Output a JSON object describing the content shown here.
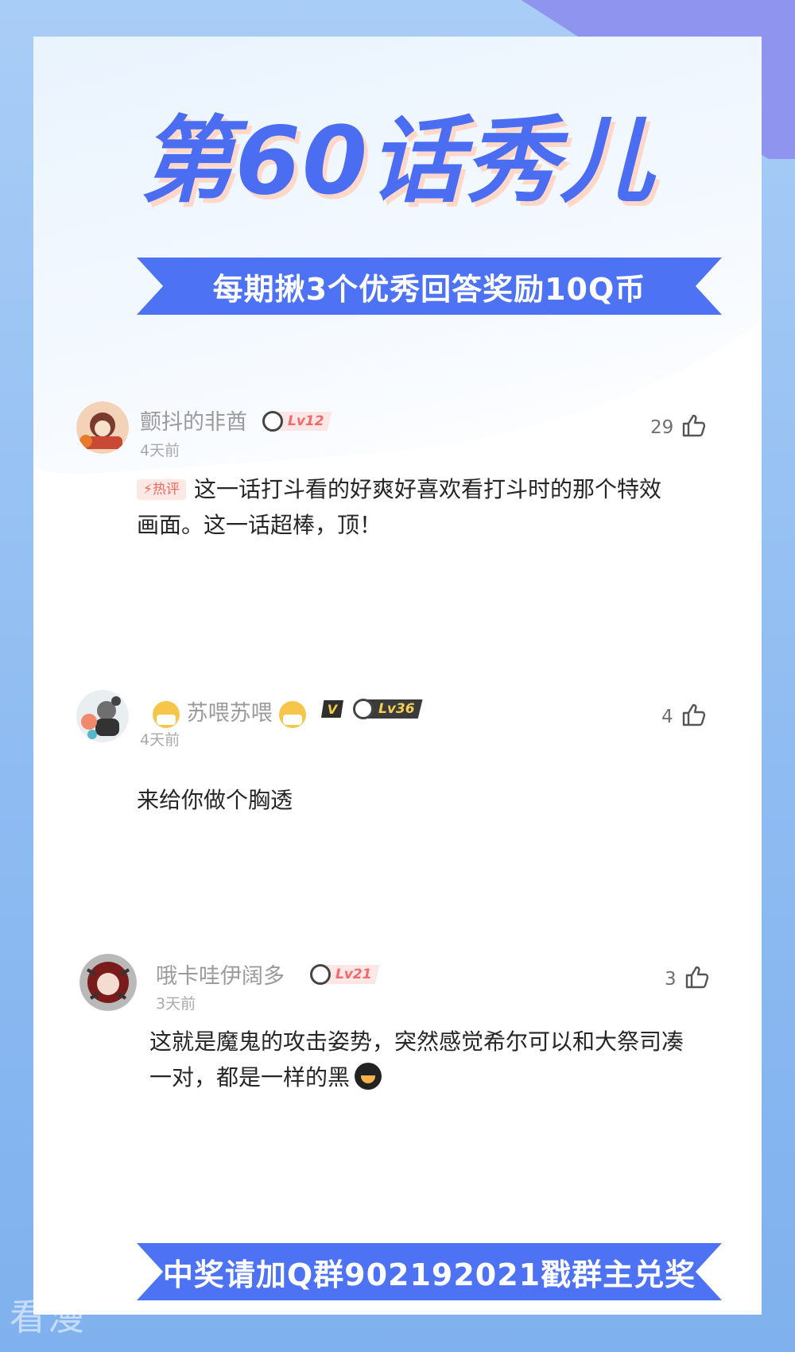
{
  "title": "第60话秀儿",
  "top_banner": "每期揪3个优秀回答奖励10Q币",
  "bottom_banner": "中奖请加Q群902192021戳群主兑奖",
  "watermark": "看漫",
  "hot_label": "热评",
  "comments": [
    {
      "username": "颤抖的非酋",
      "level": "Lv12",
      "time": "4天前",
      "likes": "29",
      "is_hot": true,
      "text": "这一话打斗看的好爽好喜欢看打斗时的那个特效画面。这一话超棒，顶！"
    },
    {
      "username": "苏喂苏喂",
      "vip_badge": "V",
      "level": "Lv36",
      "time": "4天前",
      "likes": "4",
      "text": "来给你做个胸透"
    },
    {
      "username": "哦卡哇伊阔多",
      "level": "Lv21",
      "time": "3天前",
      "likes": "3",
      "text": "这就是魔鬼的攻击姿势，突然感觉希尔可以和大祭司凑一对，都是一样的黑"
    }
  ],
  "colors": {
    "accent": "#4d72f4",
    "title": "#4a6df2",
    "hot": "#ee6b5d"
  }
}
